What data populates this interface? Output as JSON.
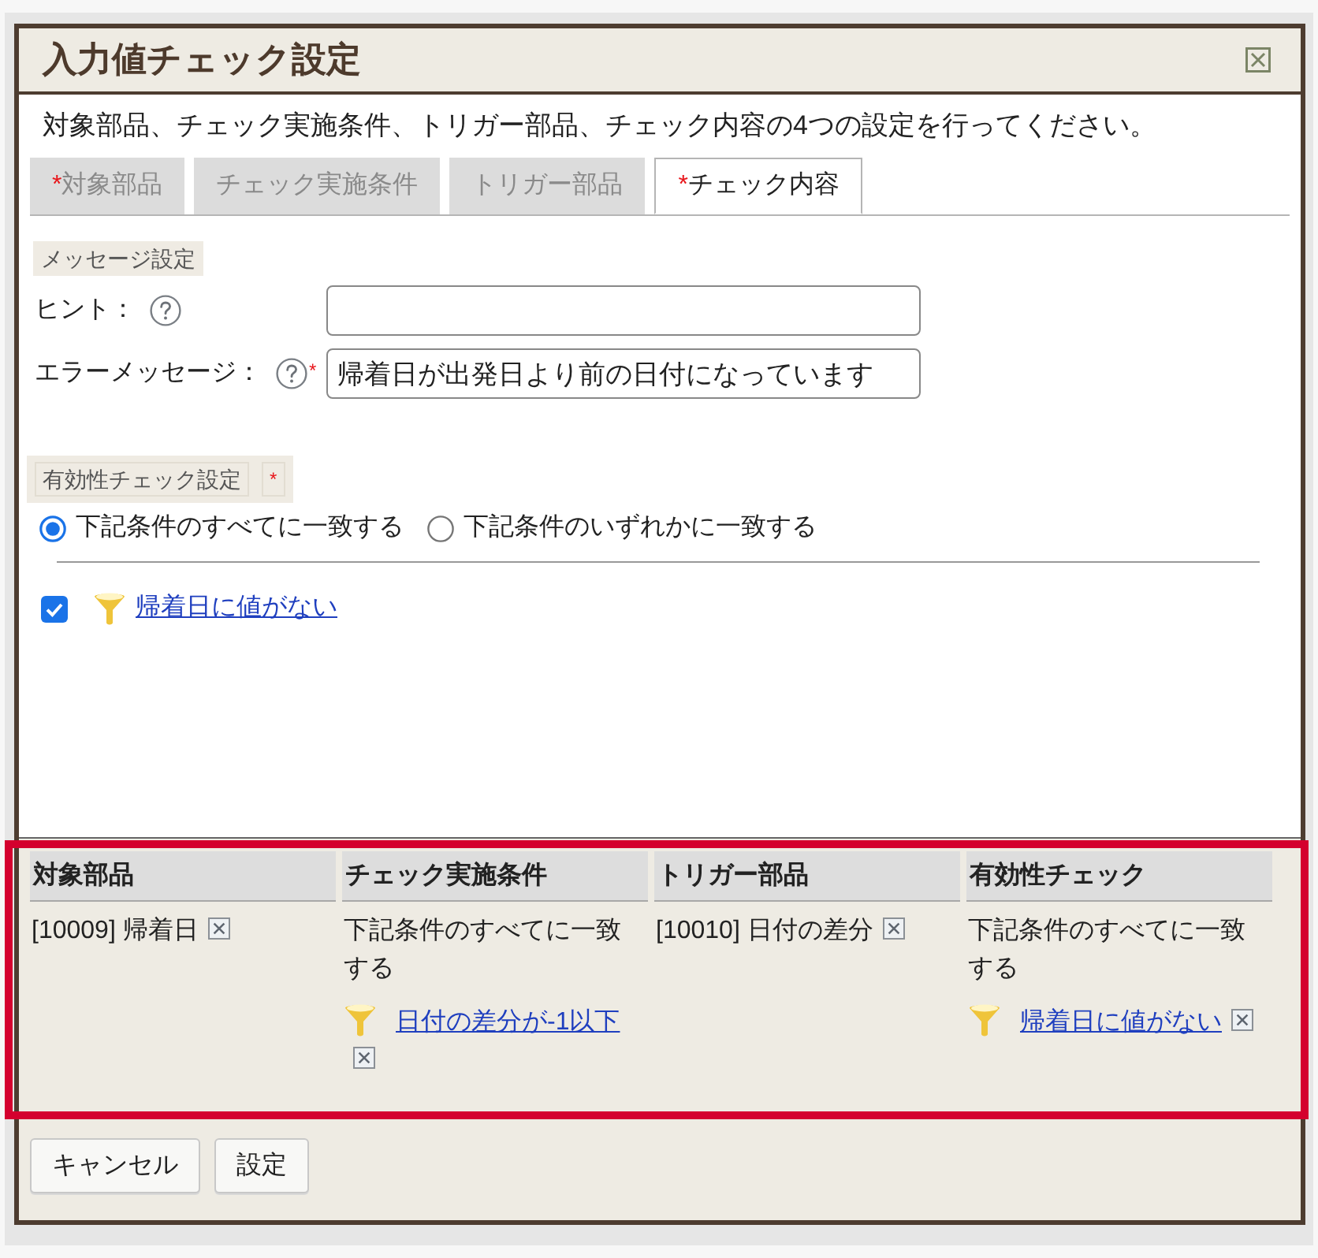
{
  "window": {
    "title": "入力値チェック設定"
  },
  "description": "対象部品、チェック実施条件、トリガー部品、チェック内容の4つの設定を行ってください。",
  "tabs": [
    {
      "label": "対象部品",
      "required_mark": "*",
      "selected": false
    },
    {
      "label": "チェック実施条件",
      "selected": false
    },
    {
      "label": "トリガー部品",
      "selected": false
    },
    {
      "label": "チェック内容",
      "required_mark": "*",
      "selected": true
    }
  ],
  "message_settings": {
    "heading": "メッセージ設定",
    "fields": [
      {
        "label": "ヒント："
      },
      {
        "label": "エラーメッセージ：",
        "required_mark": "*",
        "value": "帰着日が出発日より前の日付になっています"
      }
    ]
  },
  "validity_settings": {
    "heading": "有効性チェック設定",
    "required_mark": "*",
    "match_options": [
      {
        "label": "下記条件のすべてに一致する",
        "selected": true
      },
      {
        "label": "下記条件のいずれかに一致する",
        "selected": false
      }
    ],
    "conditions": [
      {
        "label": "帰着日に値がない",
        "checked": true
      }
    ]
  },
  "summary": {
    "highlighted": true,
    "columns": [
      "対象部品",
      "チェック実施条件",
      "トリガー部品",
      "有効性チェック"
    ],
    "rows": [
      {
        "cells": [
          {
            "text": "[10009] 帰着日",
            "removable": true
          },
          {
            "text": "下記条件のすべてに一致する",
            "conditions": [
              {
                "label": "日付の差分が-1以下",
                "removable": true
              }
            ]
          },
          {
            "text": "[10010] 日付の差分",
            "removable": true
          },
          {
            "text": "下記条件のすべてに一致する",
            "conditions": [
              {
                "label": "帰着日に値がない",
                "removable": true
              }
            ]
          }
        ]
      }
    ]
  },
  "buttons": [
    "キャンセル",
    "設定"
  ]
}
